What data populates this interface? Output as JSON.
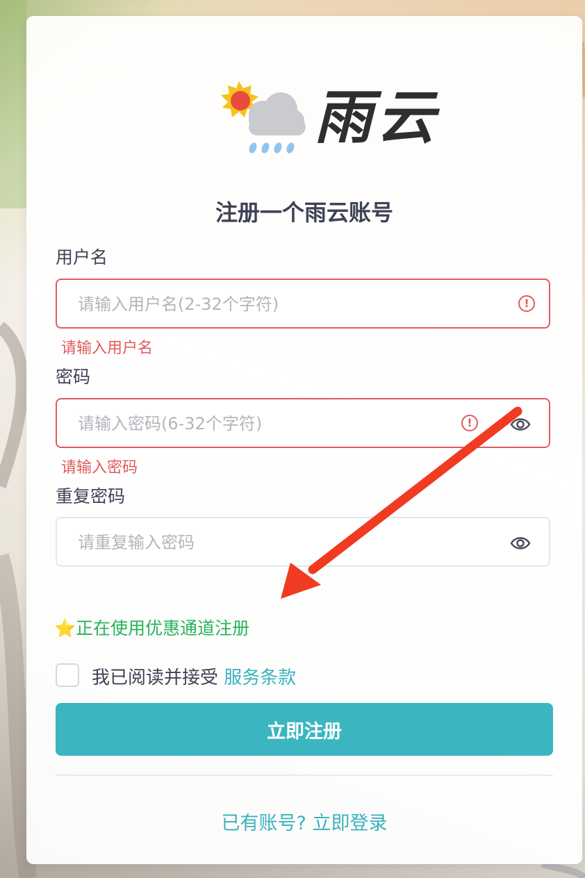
{
  "brand": {
    "name": "雨云"
  },
  "page": {
    "title": "注册一个雨云账号"
  },
  "form": {
    "username": {
      "label": "用户名",
      "placeholder": "请输入用户名(2-32个字符)",
      "value": "",
      "error": "请输入用户名"
    },
    "password": {
      "label": "密码",
      "placeholder": "请输入密码(6-32个字符)",
      "value": "",
      "error": "请输入密码"
    },
    "confirm_password": {
      "label": "重复密码",
      "placeholder": "请重复输入密码",
      "value": ""
    }
  },
  "promo": {
    "icon": "⭐",
    "text": "正在使用优惠通道注册"
  },
  "terms": {
    "checked": false,
    "prefix": "我已阅读并接受 ",
    "link": "服务条款"
  },
  "submit": {
    "label": "立即注册"
  },
  "login": {
    "text": "已有账号? 立即登录"
  },
  "colors": {
    "accent": "#3bb6c0",
    "error": "#e05a5a",
    "promo": "#27b35a",
    "annotation_arrow": "#f03a22"
  }
}
